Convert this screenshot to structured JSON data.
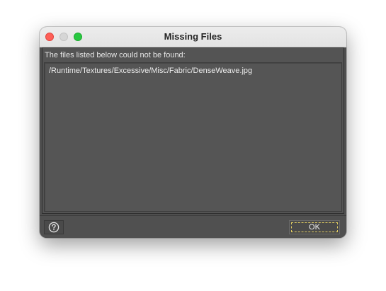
{
  "window": {
    "title": "Missing Files"
  },
  "content": {
    "header": "The files listed below could not be found:",
    "files": [
      "/Runtime/Textures/Excessive/Misc/Fabric/DenseWeave.jpg"
    ]
  },
  "buttons": {
    "help_icon": "question-mark-circle-icon",
    "ok_label": "OK"
  },
  "colors": {
    "close": "#fe5f57",
    "minimize": "#d6d6d6",
    "zoom": "#28c840",
    "panel_bg": "#545454",
    "focus_ring": "#e0cc62"
  }
}
